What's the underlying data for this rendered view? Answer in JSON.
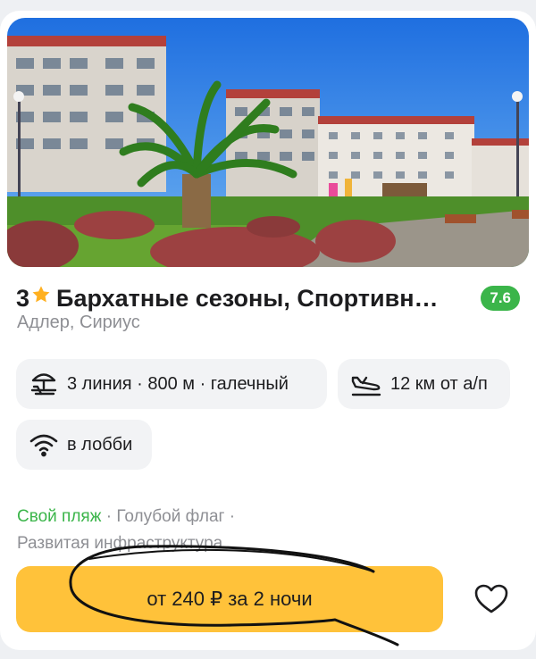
{
  "hotel": {
    "stars": "3",
    "name": "Бархатные сезоны, Спортивн…",
    "rating": "7.6",
    "location": "Адлер, Сириус"
  },
  "chips": {
    "beach": "3 линия · 800 м · галечный",
    "airport": "12 км от а/п",
    "wifi": "в лобби"
  },
  "features": {
    "own_beach": "Свой пляж",
    "sep1": " · ",
    "blue_flag": "Голубой флаг",
    "sep2": " ·",
    "infrastructure": "Развитая инфраструктура"
  },
  "price_button": "от 240 ₽ за 2 ночи",
  "colors": {
    "accent": "#ffc23a",
    "rating_green": "#3bb54a",
    "muted_text": "#8e8f94"
  },
  "icons": [
    "star-icon",
    "beach-umbrella-icon",
    "airplane-landing-icon",
    "wifi-icon",
    "heart-icon"
  ]
}
